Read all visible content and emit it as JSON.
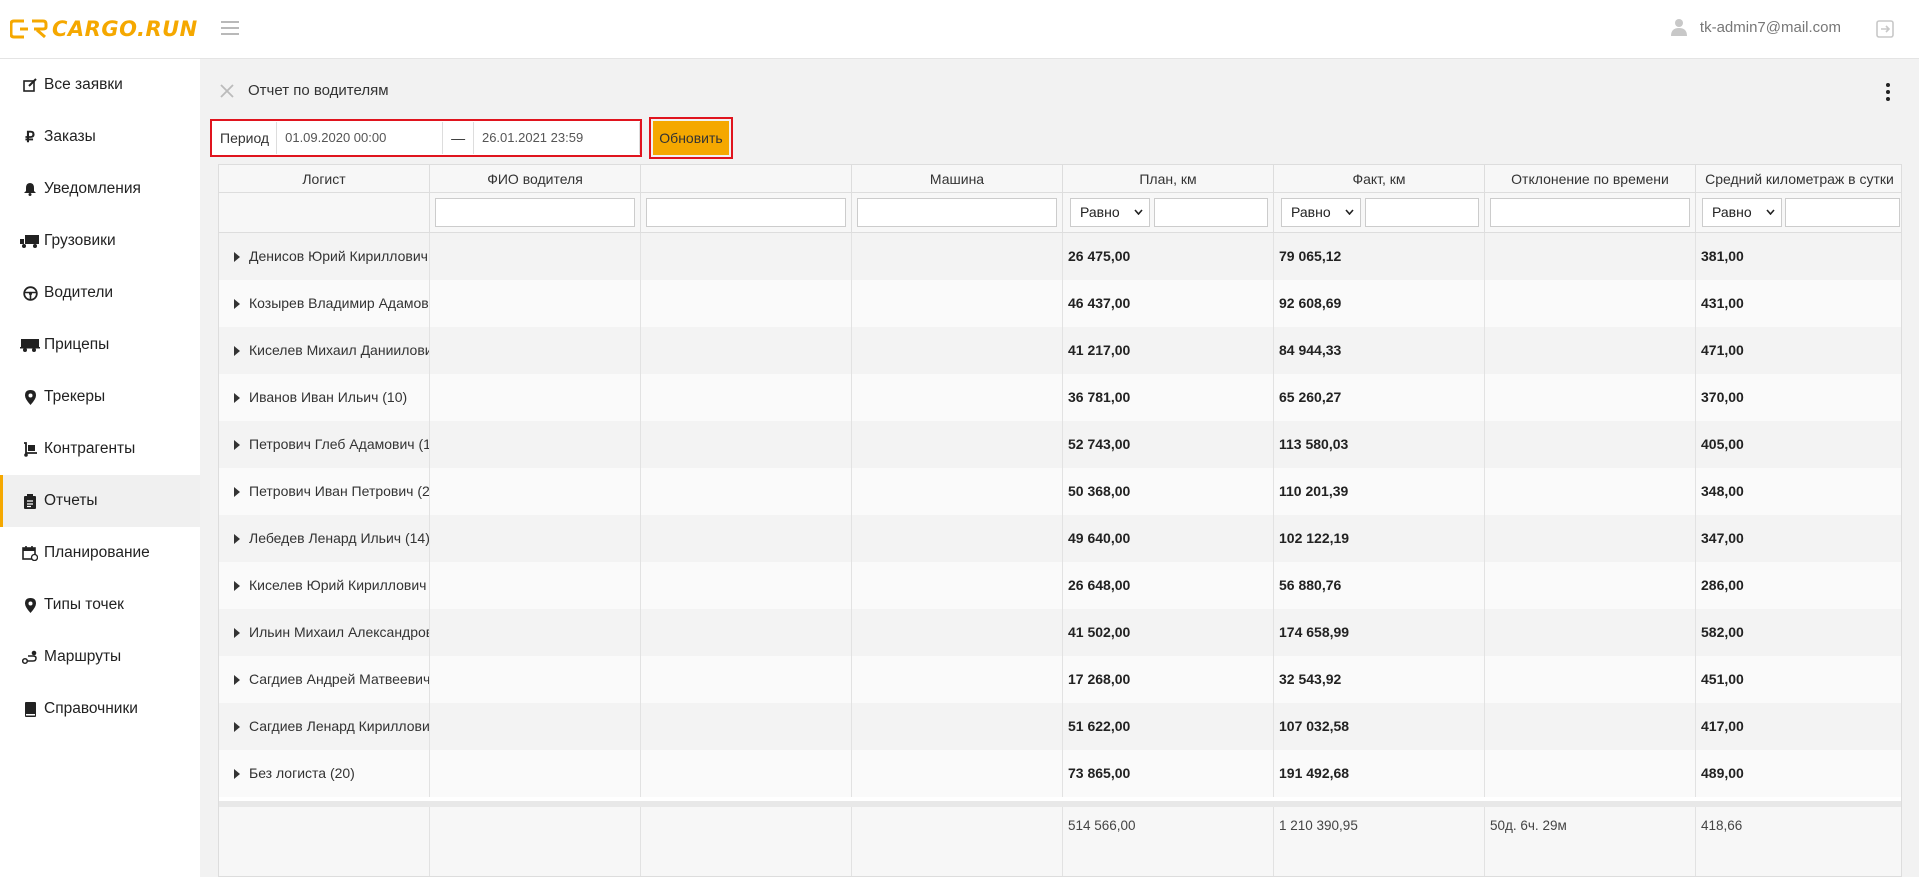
{
  "app": {
    "logo_text": "CARGO.RUN",
    "brand_color": "#f5a800"
  },
  "header": {
    "user_email": "tk-admin7@mail.com"
  },
  "sidebar": {
    "items": [
      {
        "label": "Все заявки",
        "icon": "edit-icon"
      },
      {
        "label": "Заказы",
        "icon": "ruble-icon"
      },
      {
        "label": "Уведомления",
        "icon": "bell-icon"
      },
      {
        "label": "Грузовики",
        "icon": "truck-icon"
      },
      {
        "label": "Водители",
        "icon": "steering-wheel-icon"
      },
      {
        "label": "Прицепы",
        "icon": "trailer-icon"
      },
      {
        "label": "Трекеры",
        "icon": "map-pin-icon"
      },
      {
        "label": "Контрагенты",
        "icon": "dolly-icon"
      },
      {
        "label": "Отчеты",
        "icon": "clipboard-icon",
        "active": true
      },
      {
        "label": "Планирование",
        "icon": "calendar-icon"
      },
      {
        "label": "Типы точек",
        "icon": "map-pin-icon"
      },
      {
        "label": "Маршруты",
        "icon": "route-icon"
      },
      {
        "label": "Справочники",
        "icon": "book-icon"
      }
    ]
  },
  "report": {
    "title": "Отчет по водителям",
    "period_label": "Период",
    "date_from": "01.09.2020 00:00",
    "date_sep": "—",
    "date_to": "26.01.2021 23:59",
    "refresh_label": "Обновить"
  },
  "table": {
    "columns": [
      "Логист",
      "ФИО водителя",
      "",
      "Машина",
      "План, км",
      "Факт, км",
      "Отклонение по времени",
      "Средний километраж в сутки"
    ],
    "filter_select_value": "Равно",
    "rows": [
      {
        "logist": "Денисов Юрий Кириллович (",
        "plan": "26 475,00",
        "fact": "79 065,12",
        "avg": "381,00"
      },
      {
        "logist": "Козырев Владимир Адамович",
        "plan": "46 437,00",
        "fact": "92 608,69",
        "avg": "431,00"
      },
      {
        "logist": "Киселев Михаил Даниилович",
        "plan": "41 217,00",
        "fact": "84 944,33",
        "avg": "471,00"
      },
      {
        "logist": "Иванов Иван Ильич (10)",
        "plan": "36 781,00",
        "fact": "65 260,27",
        "avg": "370,00"
      },
      {
        "logist": "Петрович Глеб Адамович (1",
        "plan": "52 743,00",
        "fact": "113 580,03",
        "avg": "405,00"
      },
      {
        "logist": "Петрович Иван Петрович (2",
        "plan": "50 368,00",
        "fact": "110 201,39",
        "avg": "348,00"
      },
      {
        "logist": "Лебедев Ленард Ильич (14)",
        "plan": "49 640,00",
        "fact": "102 122,19",
        "avg": "347,00"
      },
      {
        "logist": "Киселев Юрий Кириллович (",
        "plan": "26 648,00",
        "fact": "56 880,76",
        "avg": "286,00"
      },
      {
        "logist": "Ильин Михаил Александрович",
        "plan": "41 502,00",
        "fact": "174 658,99",
        "avg": "582,00"
      },
      {
        "logist": "Сагдиев Андрей Матвеевич (",
        "plan": "17 268,00",
        "fact": "32 543,92",
        "avg": "451,00"
      },
      {
        "logist": "Сагдиев Ленард Кириллович",
        "plan": "51 622,00",
        "fact": "107 032,58",
        "avg": "417,00"
      },
      {
        "logist": "Без логиста (20)",
        "plan": "73 865,00",
        "fact": "191 492,68",
        "avg": "489,00"
      }
    ],
    "totals": {
      "plan": "514 566,00",
      "fact": "1 210 390,95",
      "deviation": "50д. 6ч. 29м",
      "avg": "418,66"
    }
  }
}
